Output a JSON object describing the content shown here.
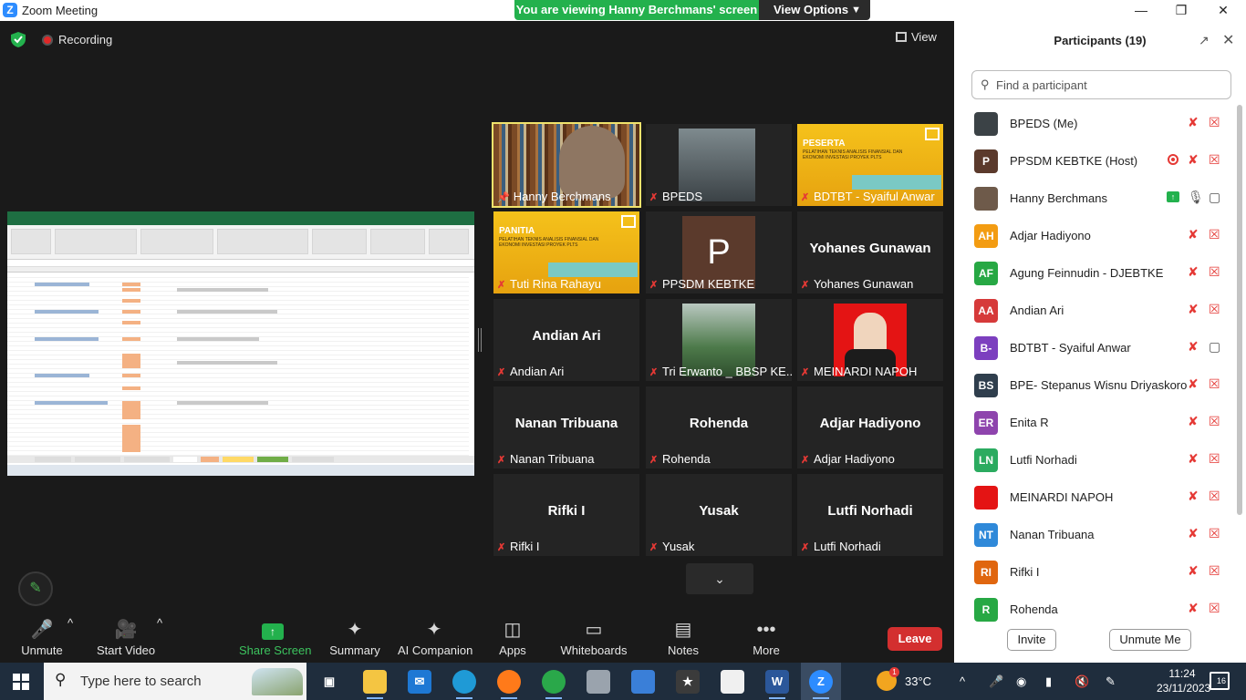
{
  "window": {
    "title": "Zoom Meeting",
    "minimize": "—",
    "restore": "❐",
    "close": "✕"
  },
  "banner": {
    "viewing_text": "You are viewing Hanny Berchmans' screen",
    "view_options_label": "View Options"
  },
  "meeting": {
    "recording_label": "Recording",
    "view_label": "View"
  },
  "tiles": [
    {
      "name": "Hanny Berchmans",
      "muted": false,
      "pinned": true,
      "active": true,
      "display": "video"
    },
    {
      "name": "BPEDS",
      "muted": true,
      "display": "video"
    },
    {
      "name": "BDTBT - Syaiful Anwar",
      "muted": true,
      "display": "banner",
      "banner_title": "PESERTA",
      "banner_subtitle": "PELATIHAN TEKNIS ANALISIS FINANSIAL DAN EKONOMI INVESTASI PROYEK PLTS"
    },
    {
      "name": "Tuti Rina Rahayu",
      "muted": true,
      "display": "banner",
      "banner_title": "PANITIA",
      "banner_subtitle": "PELATIHAN TEKNIS ANALISIS FINANSIAL DAN EKONOMI INVESTASI PROYEK PLTS"
    },
    {
      "name": "PPSDM KEBTKE",
      "muted": true,
      "display": "avatar",
      "initial": "P"
    },
    {
      "name": "Yohanes Gunawan",
      "muted": true,
      "display": "name"
    },
    {
      "name": "Andian Ari",
      "muted": true,
      "display": "name"
    },
    {
      "name": "Tri Erwanto _ BBSP KE...",
      "muted": true,
      "display": "video"
    },
    {
      "name": "MEINARDI NAPOH",
      "muted": true,
      "display": "photo"
    },
    {
      "name": "Nanan Tribuana",
      "muted": true,
      "display": "name"
    },
    {
      "name": "Rohenda",
      "muted": true,
      "display": "name"
    },
    {
      "name": "Adjar Hadiyono",
      "muted": true,
      "display": "name"
    },
    {
      "name": "Rifki I",
      "muted": true,
      "display": "name"
    },
    {
      "name": "Yusak",
      "muted": true,
      "display": "name"
    },
    {
      "name": "Lutfi Norhadi",
      "muted": true,
      "display": "name"
    }
  ],
  "toolbar": {
    "unmute": "Unmute",
    "start_video": "Start Video",
    "share_screen": "Share Screen",
    "summary": "Summary",
    "ai_companion": "AI Companion",
    "apps": "Apps",
    "whiteboards": "Whiteboards",
    "notes": "Notes",
    "more": "More",
    "leave": "Leave"
  },
  "participants_panel": {
    "title": "Participants (19)",
    "search_placeholder": "Find a participant",
    "invite_label": "Invite",
    "unmute_me_label": "Unmute Me",
    "participants": [
      {
        "name": "BPEDS (Me)",
        "avatar": "photo",
        "color": "#3b4246",
        "mic": "muted",
        "cam": "off"
      },
      {
        "name": "PPSDM KEBTKE (Host)",
        "avatar": "P",
        "color": "#5b3a2c",
        "mic": "muted",
        "cam": "off",
        "recording": true
      },
      {
        "name": "Hanny Berchmans",
        "avatar": "photo",
        "color": "#6e5a4a",
        "mic": "on",
        "cam": "on",
        "sharing": true
      },
      {
        "name": "Adjar Hadiyono",
        "avatar": "AH",
        "color": "#f39c12",
        "mic": "muted",
        "cam": "off"
      },
      {
        "name": "Agung Feinnudin - DJEBTKE",
        "avatar": "AF",
        "color": "#27a844",
        "mic": "muted",
        "cam": "off"
      },
      {
        "name": "Andian Ari",
        "avatar": "AA",
        "color": "#d63a3a",
        "mic": "muted",
        "cam": "off"
      },
      {
        "name": "BDTBT - Syaiful Anwar",
        "avatar": "B-",
        "color": "#7c3fbf",
        "mic": "muted",
        "cam": "on"
      },
      {
        "name": "BPE- Stepanus Wisnu Driyaskoro",
        "avatar": "BS",
        "color": "#2f3e4d",
        "mic": "muted",
        "cam": "off"
      },
      {
        "name": "Enita R",
        "avatar": "ER",
        "color": "#8e44ad",
        "mic": "muted",
        "cam": "off"
      },
      {
        "name": "Lutfi Norhadi",
        "avatar": "LN",
        "color": "#2bab60",
        "mic": "muted",
        "cam": "off"
      },
      {
        "name": "MEINARDI NAPOH",
        "avatar": "photo",
        "color": "#e41414",
        "mic": "muted",
        "cam": "off"
      },
      {
        "name": "Nanan Tribuana",
        "avatar": "NT",
        "color": "#2f89d9",
        "mic": "muted",
        "cam": "off"
      },
      {
        "name": "Rifki I",
        "avatar": "RI",
        "color": "#e0660f",
        "mic": "muted",
        "cam": "off"
      },
      {
        "name": "Rohenda",
        "avatar": "R",
        "color": "#27a844",
        "mic": "muted",
        "cam": "off"
      }
    ]
  },
  "taskbar": {
    "search_text": "Type here to search",
    "weather_badge": "1",
    "temperature": "33°C",
    "time": "11:24",
    "date": "23/11/2023",
    "notification_count": "16"
  }
}
